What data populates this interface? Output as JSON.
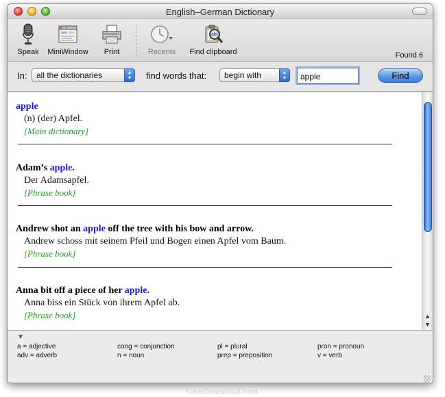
{
  "window": {
    "title": "English–German Dictionary"
  },
  "toolbar": {
    "items": [
      {
        "label": "Speak",
        "icon": "microphone-icon",
        "enabled": true
      },
      {
        "label": "MiniWindow",
        "icon": "mini-window-icon",
        "enabled": true
      },
      {
        "label": "Print",
        "icon": "printer-icon",
        "enabled": true
      },
      {
        "label": "Recents",
        "icon": "clock-icon",
        "enabled": false
      },
      {
        "label": "Find clipboard",
        "icon": "clipboard-magnifier-icon",
        "enabled": true
      }
    ],
    "found": "Found 6"
  },
  "search": {
    "in_label": "In:",
    "dictionary": "all the dictionaries",
    "find_label": "find words that:",
    "mode": "begin with",
    "query": "apple",
    "find_button": "Find"
  },
  "results": [
    {
      "pre": "",
      "match": "apple",
      "post": "",
      "translation": "(n) (der) Apfel.",
      "source": "[Main dictionary]"
    },
    {
      "pre": "Adam’s ",
      "match": "apple",
      "post": ".",
      "translation": "Der Adamsapfel.",
      "source": "[Phrase book]"
    },
    {
      "pre": "Andrew shot an ",
      "match": "apple",
      "post": " off the tree with his bow and arrow.",
      "translation": "Andrew schoss mit seinem Pfeil und Bogen einen Apfel vom Baum.",
      "source": "[Phrase book]"
    },
    {
      "pre": "Anna bit off a piece of her ",
      "match": "apple",
      "post": ".",
      "translation": "Anna biss ein Stück von ihrem Apfel ab.",
      "source": "[Phrase book]"
    }
  ],
  "legend": [
    "a = adjective",
    "cong = conjunction",
    "pl = plural",
    "pron = pronoun",
    "adv = adverb",
    "n = noun",
    "prep = preposition",
    "v = verb"
  ],
  "watermark": "GearDownload.com",
  "colors": {
    "highlight": "#1a1ad6",
    "source": "#1e9b1e",
    "accent": "#3b7fdc"
  }
}
